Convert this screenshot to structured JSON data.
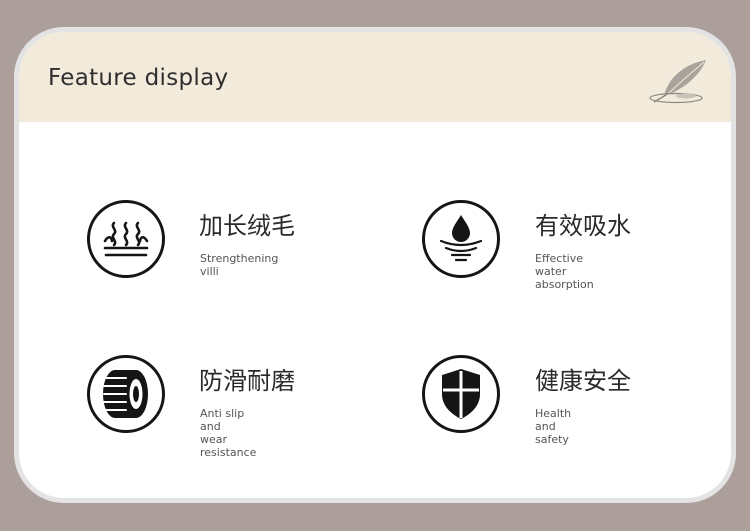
{
  "header": {
    "title": "Feature display",
    "decoration_icon": "feather-quill-icon"
  },
  "features": [
    {
      "icon": "heat-waves-icon",
      "title": "加长绒毛",
      "subtitle_lines": [
        "Strengthening villi"
      ]
    },
    {
      "icon": "water-drop-icon",
      "title": "有效吸水",
      "subtitle_lines": [
        "Effective water",
        "absorption"
      ]
    },
    {
      "icon": "tire-icon",
      "title": "防滑耐磨",
      "subtitle_lines": [
        "Anti slip and",
        "wear resistance"
      ]
    },
    {
      "icon": "shield-cross-icon",
      "title": "健康安全",
      "subtitle_lines": [
        "Health and safety"
      ]
    }
  ],
  "colors": {
    "page_background": "#ac9f9b",
    "header_background": "#f2ebdc",
    "card_background": "#ffffff",
    "icon_stroke": "#151515"
  }
}
